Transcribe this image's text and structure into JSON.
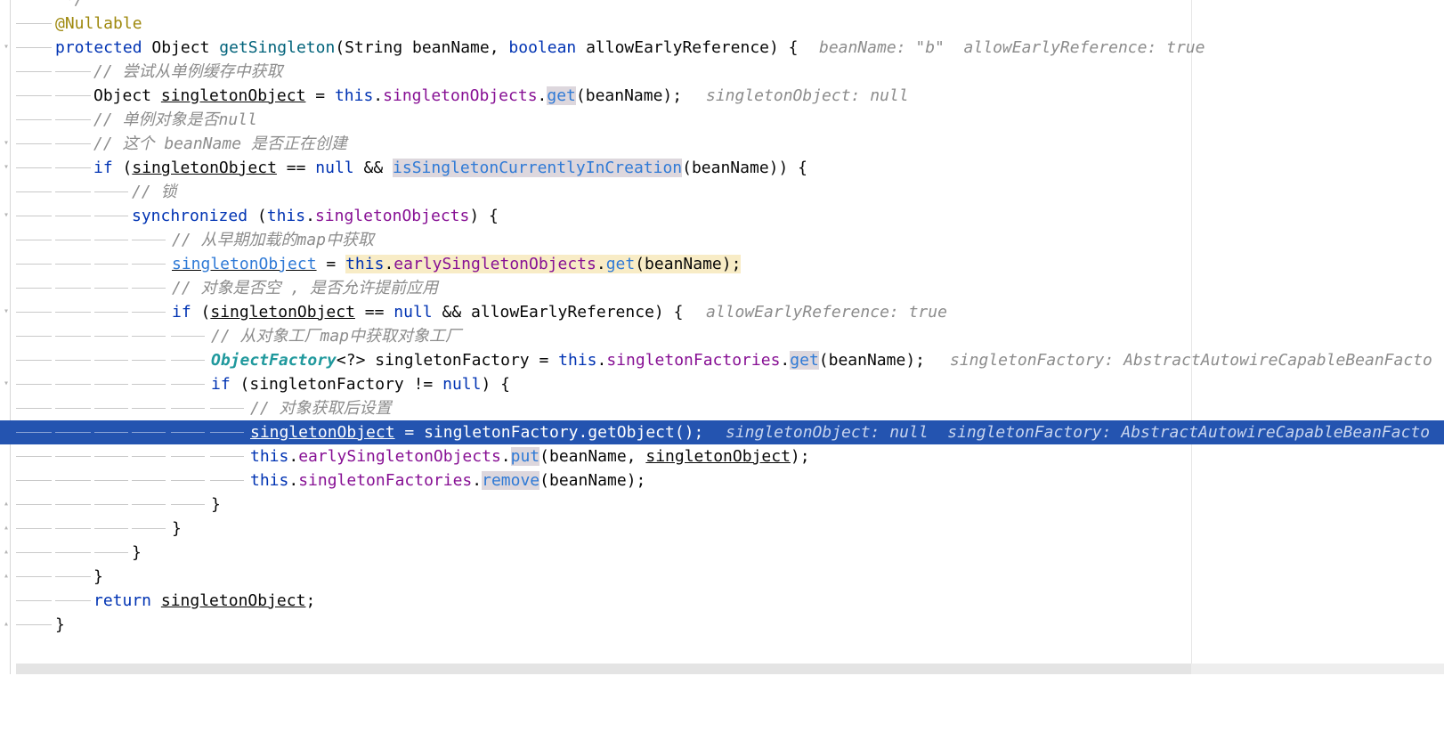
{
  "editor": {
    "lines": [
      {
        "text": " */",
        "indent": 1
      },
      {
        "text": "@Nullable",
        "indent": 1
      },
      {
        "text": "protected Object getSingleton(String beanName, boolean allowEarlyReference) {",
        "hint": "beanName: \"b\"  allowEarlyReference: true",
        "indent": 1
      },
      {
        "text": "// 尝试从单例缓存中获取",
        "indent": 2
      },
      {
        "text": "Object singletonObject = this.singletonObjects.get(beanName);",
        "hint": "singletonObject: null",
        "indent": 2
      },
      {
        "text": "// 单例对象是否null",
        "indent": 2
      },
      {
        "text": "// 这个 beanName 是否正在创建",
        "indent": 2
      },
      {
        "text": "if (singletonObject == null && isSingletonCurrentlyInCreation(beanName)) {",
        "indent": 2
      },
      {
        "text": "// 锁",
        "indent": 3
      },
      {
        "text": "synchronized (this.singletonObjects) {",
        "indent": 3
      },
      {
        "text": "// 从早期加载的map中获取",
        "indent": 4
      },
      {
        "text": "singletonObject = this.earlySingletonObjects.get(beanName);",
        "indent": 4
      },
      {
        "text": "// 对象是否空 , 是否允许提前应用",
        "indent": 4
      },
      {
        "text": "if (singletonObject == null && allowEarlyReference) {",
        "hint": "allowEarlyReference: true",
        "indent": 4
      },
      {
        "text": "// 从对象工厂map中获取对象工厂",
        "indent": 5
      },
      {
        "text": "ObjectFactory<?> singletonFactory = this.singletonFactories.get(beanName);",
        "hint": "singletonFactory: AbstractAutowireCapableBeanFacto",
        "indent": 5
      },
      {
        "text": "if (singletonFactory != null) {",
        "indent": 5
      },
      {
        "text": "// 对象获取后设置",
        "indent": 6
      },
      {
        "text": "singletonObject = singletonFactory.getObject();",
        "hint": "singletonObject: null  singletonFactory: AbstractAutowireCapableBeanFacto",
        "indent": 6,
        "selected": true
      },
      {
        "text": "this.earlySingletonObjects.put(beanName, singletonObject);",
        "indent": 6
      },
      {
        "text": "this.singletonFactories.remove(beanName);",
        "indent": 6
      },
      {
        "text": "}",
        "indent": 5
      },
      {
        "text": "}",
        "indent": 4
      },
      {
        "text": "}",
        "indent": 3
      },
      {
        "text": "}",
        "indent": 2
      },
      {
        "text": "return singletonObject;",
        "indent": 2
      },
      {
        "text": "}",
        "indent": 1
      }
    ]
  },
  "colors": {
    "selection": "#2454b0",
    "keyword": "#0033b3",
    "field": "#871094",
    "comment": "#8c8c8c",
    "annotation": "#9e880d"
  }
}
